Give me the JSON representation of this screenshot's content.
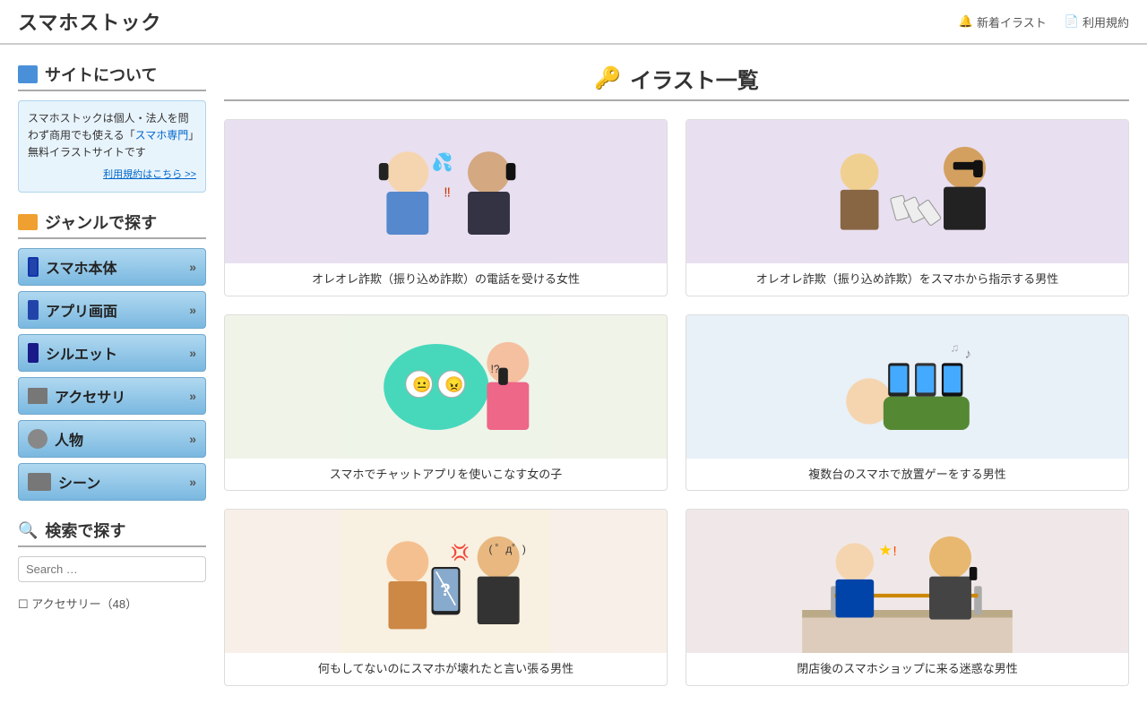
{
  "header": {
    "logo": "スマホストック",
    "links": [
      {
        "label": "新着イラスト",
        "icon": "bell"
      },
      {
        "label": "利用規約",
        "icon": "document"
      }
    ]
  },
  "sidebar": {
    "about_title": "サイトについて",
    "about_text_1": "スマホストックは個人・法人を問わず商用でも使える「",
    "about_highlight": "スマホ専門",
    "about_text_2": "」無料イラストサイトです",
    "about_terms": "利用規約はこちら >>",
    "genre_title": "ジャンルで探す",
    "genre_items": [
      {
        "label": "スマホ本体",
        "icon": "smartphone"
      },
      {
        "label": "アプリ画面",
        "icon": "app"
      },
      {
        "label": "シルエット",
        "icon": "silhouette"
      },
      {
        "label": "アクセサリ",
        "icon": "accessory"
      },
      {
        "label": "人物",
        "icon": "person"
      },
      {
        "label": "シーン",
        "icon": "scene"
      }
    ],
    "search_title": "検索で探す",
    "search_placeholder": "Search …",
    "category_header": "アクセサリー（48）"
  },
  "content": {
    "title": "イラスト一覧",
    "title_icon": "key",
    "illustrations": [
      {
        "id": 1,
        "caption": "オレオレ詐欺（振り込め詐欺）の電話を受ける女性",
        "bg": "#e8dff0"
      },
      {
        "id": 2,
        "caption": "オレオレ詐欺（振り込め詐欺）をスマホから指示する男性",
        "bg": "#e8dff0"
      },
      {
        "id": 3,
        "caption": "スマホでチャットアプリを使いこなす女の子",
        "bg": "#eef4e8"
      },
      {
        "id": 4,
        "caption": "複数台のスマホで放置ゲーをする男性",
        "bg": "#e8f0f8"
      },
      {
        "id": 5,
        "caption": "何もしてないのにスマホが壊れたと言い張る男性",
        "bg": "#f8f0e0"
      },
      {
        "id": 6,
        "caption": "閉店後のスマホショップに来る迷惑な男性",
        "bg": "#f0e8e8"
      }
    ]
  }
}
